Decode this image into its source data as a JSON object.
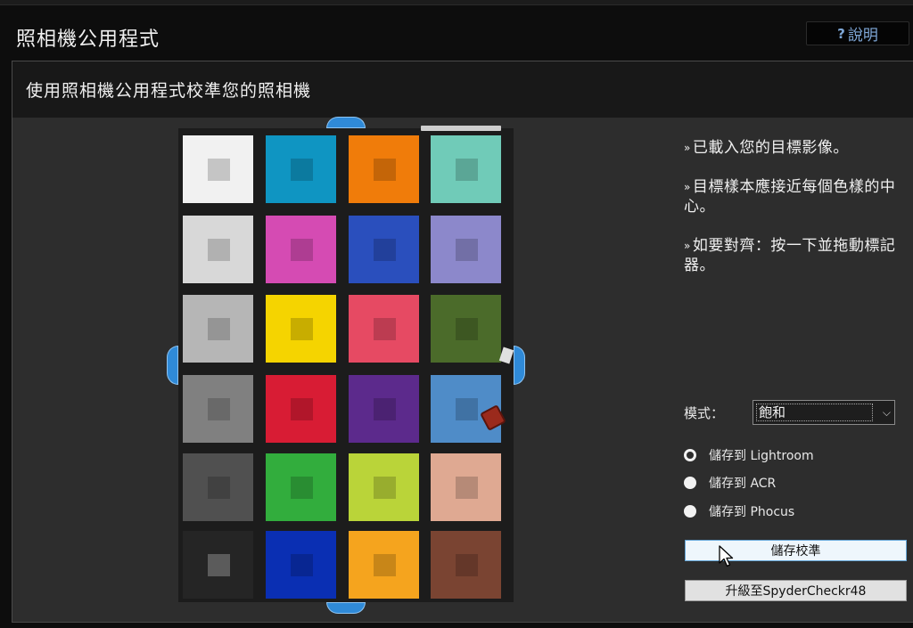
{
  "app": {
    "title": "照相機公用程式"
  },
  "help": {
    "icon": "?",
    "label": "說明"
  },
  "panel": {
    "heading": "使用照相機公用程式校準您的照相機"
  },
  "instructions": [
    "已載入您的目標影像。",
    "目標樣本應接近每個色樣的中心。",
    "如要對齊：按一下並拖動標記器。"
  ],
  "instruction_bullet": "»",
  "mode": {
    "label": "模式：",
    "selected": "飽和",
    "chevron": "⌵"
  },
  "save_options": [
    {
      "label": "儲存到 Lightroom",
      "selected": true
    },
    {
      "label": "儲存到 ACR",
      "selected": false
    },
    {
      "label": "儲存到 Phocus",
      "selected": false
    }
  ],
  "buttons": {
    "save": "儲存校準",
    "upgrade": "升級至SpyderCheckr48"
  },
  "color_chart": {
    "rows": 6,
    "cols": 4,
    "patches": [
      "#f1f1f1",
      "#0f95c2",
      "#f07c0a",
      "#70cbb8",
      "#d8d8d8",
      "#d54bb3",
      "#2a4fbd",
      "#8c88cb",
      "#b6b6b6",
      "#f5d400",
      "#e64a63",
      "#4b6b2a",
      "#808080",
      "#d81c34",
      "#5c2a8c",
      "#4f8cc8",
      "#505050",
      "#32ad3d",
      "#bad439",
      "#dfa992",
      "#252525",
      "#0a2fb3",
      "#f5a41e",
      "#7a4432"
    ]
  },
  "colors": {
    "panel_bg": "#2d2d2d",
    "header_bg": "#181818",
    "accent": "#2f8ad8",
    "help_text": "#7fa8d8"
  }
}
